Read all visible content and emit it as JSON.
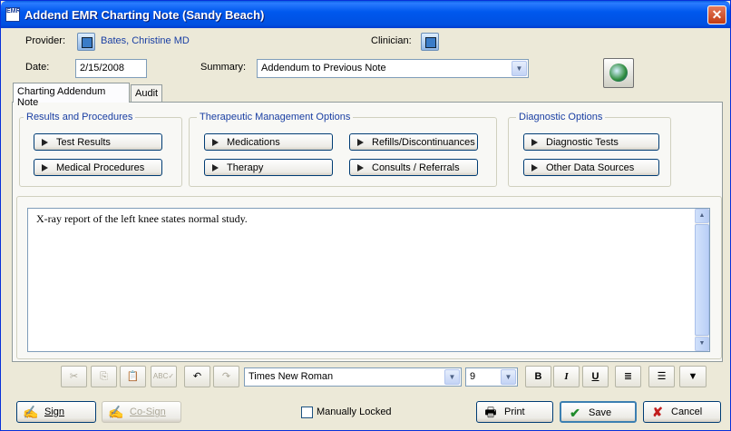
{
  "window": {
    "title": "Addend EMR Charting Note (Sandy Beach)",
    "icon_label": "EMR"
  },
  "header": {
    "provider_label": "Provider:",
    "provider_value": "Bates, Christine  MD",
    "clinician_label": "Clinician:",
    "date_label": "Date:",
    "date_value": "2/15/2008",
    "summary_label": "Summary:",
    "summary_value": "Addendum to Previous Note"
  },
  "tabs": [
    {
      "label": "Charting Addendum Note",
      "active": true
    },
    {
      "label": "Audit",
      "active": false
    }
  ],
  "groups": {
    "results": {
      "title": "Results and Procedures",
      "buttons": [
        "Test Results",
        "Medical Procedures"
      ]
    },
    "therapeutic": {
      "title": "Therapeutic Management Options",
      "buttons": [
        "Medications",
        "Refills/Discontinuances",
        "Therapy",
        "Consults / Referrals"
      ]
    },
    "diagnostic": {
      "title": "Diagnostic Options",
      "buttons": [
        "Diagnostic Tests",
        "Other Data Sources"
      ]
    }
  },
  "editor": {
    "text": "X-ray report of the left knee states normal study."
  },
  "toolbar": {
    "font": "Times New Roman",
    "size": "9",
    "bold": "B",
    "italic": "I",
    "underline": "U"
  },
  "footer": {
    "sign": "Sign",
    "cosign": "Co-Sign",
    "manually_locked": "Manually Locked",
    "print": "Print",
    "save": "Save",
    "cancel": "Cancel"
  },
  "colors": {
    "accent": "#1a3fa3",
    "titlebar": "#0058ee",
    "window_bg": "#ece9d8"
  }
}
